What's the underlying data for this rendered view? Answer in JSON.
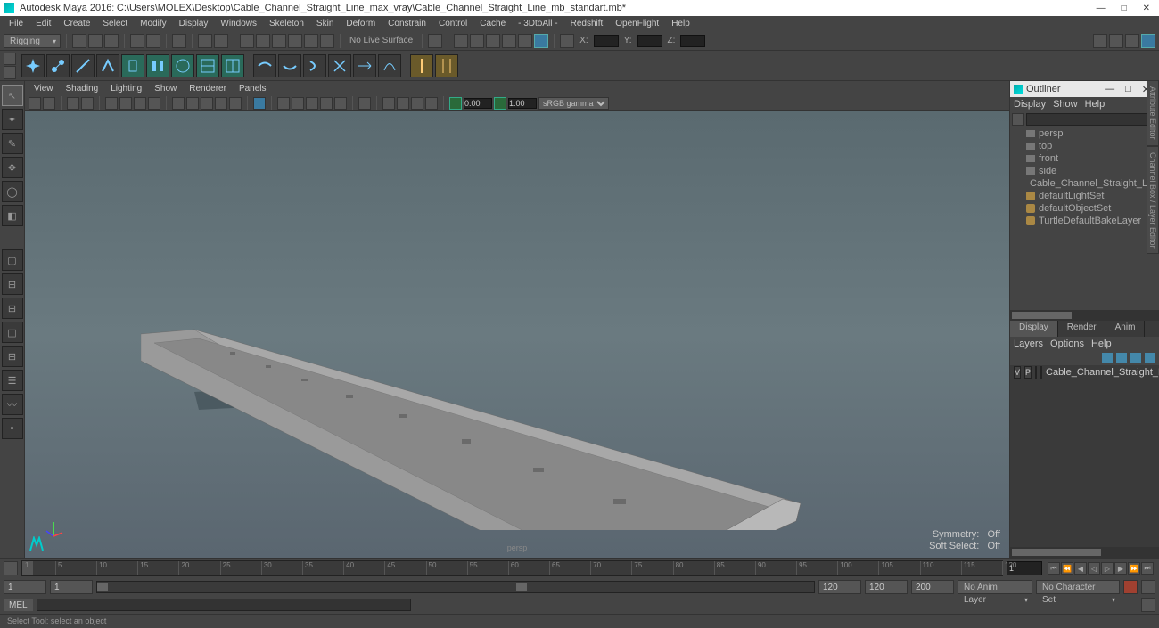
{
  "titlebar": {
    "app": "Autodesk Maya 2016",
    "path": "C:\\Users\\MOLEX\\Desktop\\Cable_Channel_Straight_Line_max_vray\\Cable_Channel_Straight_Line_mb_standart.mb*"
  },
  "menubar": [
    "File",
    "Edit",
    "Create",
    "Select",
    "Modify",
    "Display",
    "Windows",
    "Skeleton",
    "Skin",
    "Deform",
    "Constrain",
    "Control",
    "Cache",
    "- 3DtoAll -",
    "Redshift",
    "OpenFlight",
    "Help"
  ],
  "toolbar": {
    "mode": "Rigging",
    "surface": "No Live Surface",
    "xyz": {
      "x": "X:",
      "y": "Y:",
      "z": "Z:"
    }
  },
  "panel_menu": [
    "View",
    "Shading",
    "Lighting",
    "Show",
    "Renderer",
    "Panels"
  ],
  "panel_toolbar": {
    "val1": "0.00",
    "val2": "1.00",
    "colorspace": "sRGB gamma"
  },
  "viewport": {
    "camera": "persp",
    "symmetry_label": "Symmetry:",
    "symmetry_value": "Off",
    "softselect_label": "Soft Select:",
    "softselect_value": "Off"
  },
  "outliner": {
    "title": "Outliner",
    "menu": [
      "Display",
      "Show",
      "Help"
    ],
    "items": [
      {
        "type": "cam",
        "name": "persp"
      },
      {
        "type": "cam",
        "name": "top"
      },
      {
        "type": "cam",
        "name": "front"
      },
      {
        "type": "cam",
        "name": "side"
      },
      {
        "type": "mesh",
        "name": "Cable_Channel_Straight_Line_nc"
      },
      {
        "type": "set",
        "name": "defaultLightSet"
      },
      {
        "type": "set",
        "name": "defaultObjectSet"
      },
      {
        "type": "set",
        "name": "TurtleDefaultBakeLayer"
      }
    ]
  },
  "layers": {
    "tabs": [
      "Display",
      "Render",
      "Anim"
    ],
    "menu": [
      "Layers",
      "Options",
      "Help"
    ],
    "row": {
      "v": "V",
      "p": "P",
      "name": "Cable_Channel_Straight_L",
      "color": "#c04040"
    }
  },
  "timeline": {
    "ticks": [
      1,
      5,
      10,
      15,
      20,
      25,
      30,
      35,
      40,
      45,
      50,
      55,
      60,
      65,
      70,
      75,
      80,
      85,
      90,
      95,
      100,
      105,
      110,
      115,
      120
    ],
    "current_frame": "1",
    "range_start_outer": "1",
    "range_start_inner": "1",
    "range_end_inner": "120",
    "range_end_outer": "120",
    "range_end_outer2": "200",
    "anim_layer": "No Anim Layer",
    "char_set": "No Character Set"
  },
  "mel": {
    "label": "MEL"
  },
  "helpline": "Select Tool: select an object",
  "side_tabs": [
    "Attribute Editor",
    "Channel Box / Layer Editor"
  ]
}
